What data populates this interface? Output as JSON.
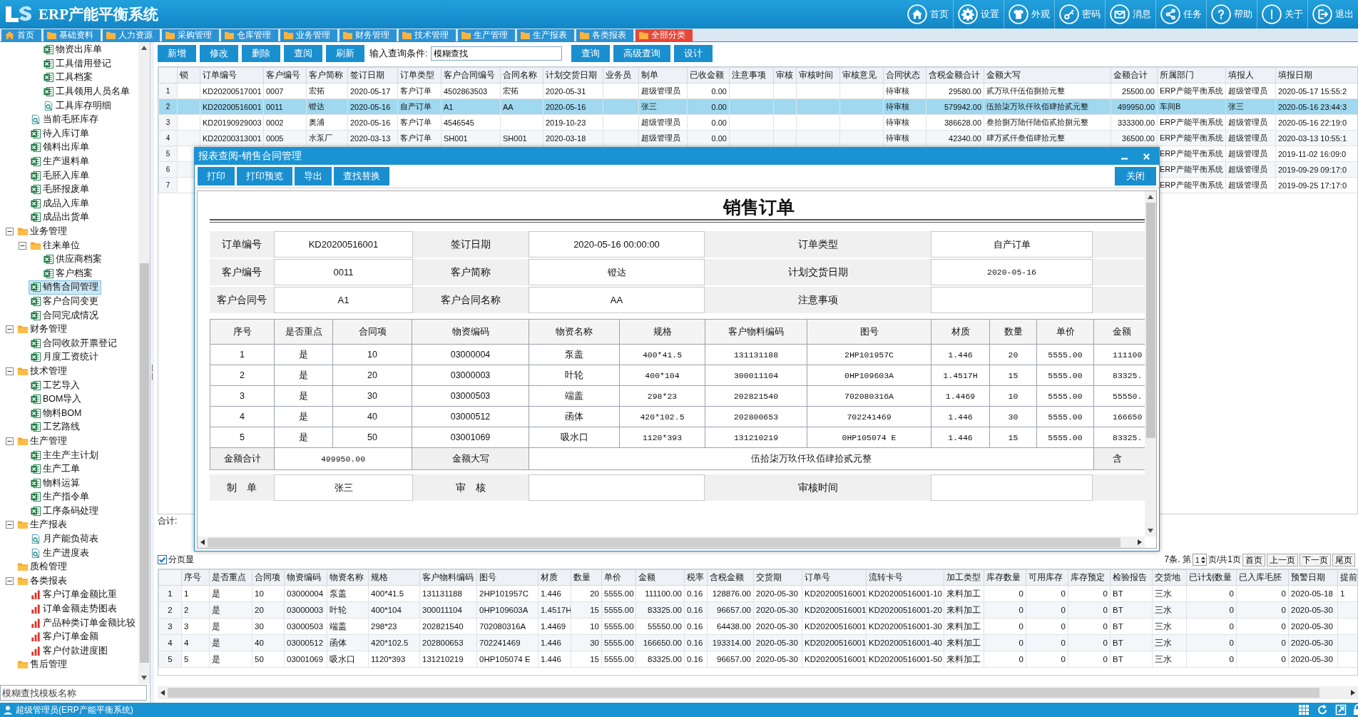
{
  "app": {
    "title": "ERP产能平衡系统"
  },
  "nav": [
    "首页",
    "设置",
    "外观",
    "密码",
    "消息",
    "任务",
    "帮助",
    "关于",
    "退出"
  ],
  "tabs": [
    {
      "label": "首页",
      "selected": false
    },
    {
      "label": "基础资料",
      "selected": false
    },
    {
      "label": "人力资源",
      "selected": false
    },
    {
      "label": "采购管理",
      "selected": false
    },
    {
      "label": "仓库管理",
      "selected": false
    },
    {
      "label": "业务管理",
      "selected": false
    },
    {
      "label": "财务管理",
      "selected": false
    },
    {
      "label": "技术管理",
      "selected": false
    },
    {
      "label": "生产管理",
      "selected": false
    },
    {
      "label": "生产报表",
      "selected": false
    },
    {
      "label": "各类报表",
      "selected": false
    },
    {
      "label": "全部分类",
      "selected": true
    }
  ],
  "sidebar": {
    "tree": [
      {
        "children": [
          {
            "children": [
              {
                "label": "物资出库单",
                "kind": "sheet",
                "selected": false
              },
              {
                "label": "工具借用登记",
                "kind": "sheet",
                "selected": false
              },
              {
                "label": "工具档案",
                "kind": "sheet",
                "selected": false
              },
              {
                "label": "工具领用人员名单",
                "kind": "sheet",
                "selected": false
              },
              {
                "label": "工具库存明细",
                "kind": "query",
                "selected": false
              }
            ]
          },
          {
            "label": "当前毛胚库存",
            "kind": "query",
            "selected": false
          },
          {
            "label": "待入库订单",
            "kind": "sheet",
            "selected": false
          },
          {
            "label": "领料出库单",
            "kind": "sheet",
            "selected": false
          },
          {
            "label": "生产退料单",
            "kind": "sheet",
            "selected": false
          },
          {
            "label": "毛胚入库单",
            "kind": "sheet",
            "selected": false
          },
          {
            "label": "毛胚报废单",
            "kind": "sheet",
            "selected": false
          },
          {
            "label": "成品入库单",
            "kind": "sheet",
            "selected": false
          },
          {
            "label": "成品出货单",
            "kind": "sheet",
            "selected": false
          }
        ]
      },
      {
        "label": "业务管理",
        "kind": "folder",
        "selected": false,
        "children": [
          {
            "label": "往来单位",
            "kind": "folder",
            "selected": false,
            "children": [
              {
                "label": "供应商档案",
                "kind": "sheet",
                "selected": false
              },
              {
                "label": "客户档案",
                "kind": "sheet",
                "selected": false
              }
            ]
          },
          {
            "label": "销售合同管理",
            "kind": "sheet",
            "selected": true
          },
          {
            "label": "客户合同变更",
            "kind": "sheet",
            "selected": false
          },
          {
            "label": "合同完成情况",
            "kind": "sheet",
            "selected": false
          }
        ]
      },
      {
        "label": "财务管理",
        "kind": "folder",
        "selected": false,
        "children": [
          {
            "label": "合同收款开票登记",
            "kind": "sheet",
            "selected": false
          },
          {
            "label": "月度工资统计",
            "kind": "sheet",
            "selected": false
          }
        ]
      },
      {
        "label": "技术管理",
        "kind": "folder",
        "selected": false,
        "children": [
          {
            "label": "工艺导入",
            "kind": "sheet",
            "selected": false
          },
          {
            "label": "BOM导入",
            "kind": "sheet",
            "selected": false
          },
          {
            "label": "物料BOM",
            "kind": "sheet",
            "selected": false
          },
          {
            "label": "工艺路线",
            "kind": "sheet",
            "selected": false
          }
        ]
      },
      {
        "label": "生产管理",
        "kind": "folder",
        "selected": false,
        "children": [
          {
            "label": "主生产主计划",
            "kind": "sheet",
            "selected": false
          },
          {
            "label": "生产工单",
            "kind": "sheet",
            "selected": false
          },
          {
            "label": "物料运算",
            "kind": "sheet",
            "selected": false
          },
          {
            "label": "生产指令单",
            "kind": "sheet",
            "selected": false
          },
          {
            "label": "工序条码处理",
            "kind": "sheet",
            "selected": false
          }
        ]
      },
      {
        "label": "生产报表",
        "kind": "folder",
        "selected": false,
        "children": [
          {
            "label": "月产能负荷表",
            "kind": "query",
            "selected": false
          },
          {
            "label": "生产进度表",
            "kind": "query",
            "selected": false
          }
        ]
      },
      {
        "label": "质检管理",
        "kind": "folder",
        "selected": false
      },
      {
        "label": "各类报表",
        "kind": "folder",
        "selected": false,
        "children": [
          {
            "label": "客户订单金额比重",
            "kind": "chart",
            "selected": false
          },
          {
            "label": "订单金额走势图表",
            "kind": "chart",
            "selected": false
          },
          {
            "label": "产品种类订单金额比较",
            "kind": "chart",
            "selected": false
          },
          {
            "label": "客户订单金额",
            "kind": "chart",
            "selected": false
          },
          {
            "label": "客户付款进度图",
            "kind": "chart",
            "selected": false
          }
        ]
      },
      {
        "label": "售后管理",
        "kind": "folder",
        "selected": false
      }
    ],
    "search": {
      "placeholder": "模糊查找模板名称"
    }
  },
  "toolbar": {
    "left_buttons": [
      "新增",
      "修改",
      "删除",
      "查阅",
      "刷新"
    ],
    "query_label": "输入查询条件:",
    "query": {
      "value": "模糊查找"
    },
    "right_buttons": [
      "查询",
      "高级查询",
      "设计"
    ]
  },
  "orders": {
    "columns": [
      "锁",
      "订单编号",
      "客户编号",
      "客户简称",
      "签订日期",
      "订单类型",
      "客户合同编号",
      "合同名称",
      "计划交货日期",
      "业务员",
      "制单",
      "已收金额",
      "注意事项",
      "审核",
      "审核时间",
      "审核意见",
      "合同状态",
      "含税金额合计",
      "金额大写",
      "金额合计",
      "所属部门",
      "填报人",
      "填报日期"
    ],
    "rows": [
      {
        "number": "1",
        "selected": false,
        "cells": [
          null,
          "KD20200517001",
          "0007",
          "宏拓",
          "2020-05-17",
          "客户订单",
          "4502863503",
          "宏拓",
          "2020-05-31",
          null,
          "超级管理员",
          "0.00",
          null,
          null,
          null,
          null,
          "待审核",
          "29580.00",
          "贰万玖仟伍佰捌拾元整",
          "25500.00",
          "ERP产能平衡系统",
          "超级管理员",
          "2020-05-17 15:55:2"
        ]
      },
      {
        "number": "2",
        "selected": true,
        "cells": [
          null,
          "KD20200516001",
          "0011",
          "镫达",
          "2020-05-16",
          "自产订单",
          "A1",
          "AA",
          "2020-05-16",
          null,
          "张三",
          "0.00",
          null,
          null,
          null,
          null,
          "待审核",
          "579942.00",
          "伍拾柒万玖仟玖佰肆拾贰元整",
          "499950.00",
          "车间B",
          "张三",
          "2020-05-16 23:44:3"
        ]
      },
      {
        "number": "3",
        "selected": false,
        "cells": [
          null,
          "KD20190929003",
          "0002",
          "奥浦",
          "2020-05-16",
          "客户订单",
          "4546545",
          null,
          "2019-10-23",
          null,
          "超级管理员",
          "0.00",
          null,
          null,
          null,
          null,
          "待审核",
          "386628.00",
          "叁拾捌万陆仟陆佰贰拾捌元整",
          "333300.00",
          "ERP产能平衡系统",
          "超级管理员",
          "2020-05-16 22:19:0"
        ]
      },
      {
        "number": "4",
        "selected": false,
        "cells": [
          null,
          "KD20200313001",
          "0005",
          "水泵厂",
          "2020-03-13",
          "客户订单",
          "SH001",
          "SH001",
          "2020-03-18",
          null,
          "超级管理员",
          "0.00",
          null,
          null,
          null,
          null,
          "待审核",
          "42340.00",
          "肆万贰仟叁佰肆拾元整",
          "36500.00",
          "ERP产能平衡系统",
          "超级管理员",
          "2020-03-13 10:55:1"
        ]
      },
      {
        "number": "5",
        "selected": false,
        "cells": [
          null,
          null,
          null,
          null,
          null,
          null,
          null,
          null,
          null,
          null,
          null,
          null,
          null,
          null,
          null,
          null,
          null,
          null,
          null,
          null,
          "ERP产能平衡系统",
          "超级管理员",
          "2019-11-02 16:09:0"
        ]
      },
      {
        "number": "6",
        "selected": false,
        "cells": [
          null,
          null,
          null,
          null,
          null,
          null,
          null,
          null,
          null,
          null,
          null,
          null,
          null,
          null,
          null,
          null,
          null,
          null,
          null,
          null,
          "ERP产能平衡系统",
          "超级管理员",
          "2019-09-29 09:17:0"
        ]
      },
      {
        "number": "7",
        "selected": false,
        "cells": [
          null,
          null,
          null,
          null,
          null,
          null,
          null,
          null,
          null,
          null,
          null,
          null,
          null,
          null,
          null,
          null,
          null,
          null,
          null,
          null,
          "ERP产能平衡系统",
          "超级管理员",
          "2019-09-25 17:17:0"
        ]
      }
    ],
    "total_label": "合计:"
  },
  "report_dialog": {
    "title": "报表查阅-销售合同管理",
    "toolbar": [
      "打印",
      "打印预览",
      "导出",
      "查找替换"
    ],
    "close_label": "关闭",
    "report_title": "销售订单",
    "header_fields": [
      [
        {
          "label": "订单编号",
          "value": "KD20200516001"
        },
        {
          "label": "签订日期",
          "value": "2020-05-16 00:00:00"
        },
        {
          "label": "订单类型",
          "value": "自产订单"
        }
      ],
      [
        {
          "label": "客户编号",
          "value": "0011"
        },
        {
          "label": "客户简称",
          "value": "镫达"
        },
        {
          "label": "计划交货日期",
          "value": "2020-05-16"
        }
      ],
      [
        {
          "label": "客户合同号",
          "value": "A1"
        },
        {
          "label": "客户合同名称",
          "value": "AA"
        },
        {
          "label": "注意事项"
        }
      ]
    ],
    "detail_columns": [
      "序号",
      "是否重点",
      "合同项",
      "物资编码",
      "物资名称",
      "规格",
      "客户物料编码",
      "图号",
      "材质",
      "数量",
      "单价",
      "金额"
    ],
    "detail_rows": [
      [
        "1",
        "是",
        "10",
        "03000004",
        "泵盖",
        "400*41.5",
        "131131188",
        "2HP101957C",
        "1.446",
        "20",
        "5555.00",
        "111100"
      ],
      [
        "2",
        "是",
        "20",
        "03000003",
        "叶轮",
        "400*104",
        "300011104",
        "0HP109603A",
        "1.4517H",
        "15",
        "5555.00",
        "83325."
      ],
      [
        "3",
        "是",
        "30",
        "03000503",
        "端盖",
        "298*23",
        "202821540",
        "702080316A",
        "1.4469",
        "10",
        "5555.00",
        "55550."
      ],
      [
        "4",
        "是",
        "40",
        "03000512",
        "函体",
        "420*102.5",
        "202800653",
        "702241469",
        "1.446",
        "30",
        "5555.00",
        "166650"
      ],
      [
        "5",
        "是",
        "50",
        "03001069",
        "吸水口",
        "1120*393",
        "131210219",
        "0HP105074 E",
        "1.446",
        "15",
        "5555.00",
        "83325."
      ]
    ],
    "total_label": "金额合计",
    "total": "499950.00",
    "words_label": "金额大写",
    "words": "伍拾柒万玖仟玖佰肆拾贰元整",
    "cut_label": "含",
    "sign_fields": [
      {
        "label": "制　单",
        "value": "张三"
      },
      {
        "label": "审　核"
      },
      {
        "label": "审核时间"
      }
    ]
  },
  "pager": {
    "toggle": {
      "label": "分页显",
      "checked": true
    },
    "count_text": "7条. 第",
    "page": "1",
    "page_total": "页/共1页",
    "buttons": [
      "首页",
      "上一页",
      "下一页",
      "尾页"
    ]
  },
  "items": {
    "columns": [
      "序号",
      "是否重点",
      "合同项",
      "物资编码",
      "物资名称",
      "规格",
      "客户物料编码",
      "图号",
      "材质",
      "数量",
      "单价",
      "金额",
      "税率",
      "含税金额",
      "交货期",
      "订单号",
      "流转卡号",
      "加工类型",
      "库存数量",
      "可用库存",
      "库存预定",
      "检验报告",
      "交货地",
      "已计划数量",
      "已入库毛胚",
      "预警日期",
      "提前"
    ],
    "rows": [
      {
        "number": "1",
        "cells": [
          "1",
          "是",
          "10",
          "03000004",
          "泵盖",
          "400*41.5",
          "131131188",
          "2HP101957C",
          "1.446",
          "20",
          "5555.00",
          "111100.00",
          "0.16",
          "128876.00",
          "2020-05-30",
          "KD20200516001",
          "KD20200516001-10",
          "来料加工",
          "0",
          "0",
          "0",
          "BT",
          "三水",
          "0",
          "0",
          "2020-05-18",
          "1"
        ]
      },
      {
        "number": "2",
        "cells": [
          "2",
          "是",
          "20",
          "03000003",
          "叶轮",
          "400*104",
          "300011104",
          "0HP109603A",
          "1.4517H",
          "15",
          "5555.00",
          "83325.00",
          "0.16",
          "96657.00",
          "2020-05-30",
          "KD20200516001",
          "KD20200516001-20",
          "来料加工",
          "0",
          "0",
          "0",
          "BT",
          "三水",
          "0",
          "0",
          "2020-05-30",
          null
        ]
      },
      {
        "number": "3",
        "cells": [
          "3",
          "是",
          "30",
          "03000503",
          "端盖",
          "298*23",
          "202821540",
          "702080316A",
          "1.4469",
          "10",
          "5555.00",
          "55550.00",
          "0.16",
          "64438.00",
          "2020-05-30",
          "KD20200516001",
          "KD20200516001-30",
          "来料加工",
          "0",
          "0",
          "0",
          "BT",
          "三水",
          "0",
          "0",
          "2020-05-30",
          null
        ]
      },
      {
        "number": "4",
        "cells": [
          "4",
          "是",
          "40",
          "03000512",
          "函体",
          "420*102.5",
          "202800653",
          "702241469",
          "1.446",
          "30",
          "5555.00",
          "166650.00",
          "0.16",
          "193314.00",
          "2020-05-30",
          "KD20200516001",
          "KD20200516001-40",
          "来料加工",
          "0",
          "0",
          "0",
          "BT",
          "三水",
          "0",
          "0",
          "2020-05-30",
          null
        ]
      },
      {
        "number": "5",
        "cells": [
          "5",
          "是",
          "50",
          "03001069",
          "吸水口",
          "1120*393",
          "131210219",
          "0HP105074 E",
          "1.446",
          "15",
          "5555.00",
          "83325.00",
          "0.16",
          "96657.00",
          "2020-05-30",
          "KD20200516001",
          "KD20200516001-50",
          "来料加工",
          "0",
          "0",
          "0",
          "BT",
          "三水",
          "0",
          "0",
          "2020-05-30",
          null
        ]
      }
    ]
  },
  "status_bar": {
    "user": "超级管理员(ERP产能平衡系统)"
  }
}
